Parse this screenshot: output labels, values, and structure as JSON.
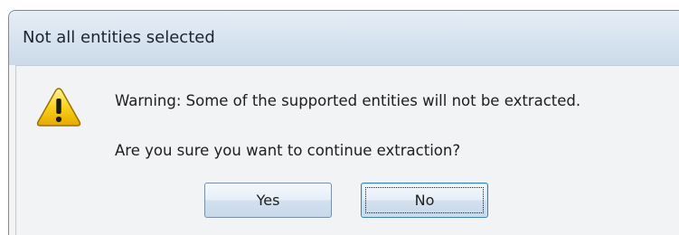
{
  "dialog": {
    "title": "Not all entities selected",
    "icon": "warning-triangle-icon",
    "warning_message": "Warning: Some of the supported entities will not be extracted.",
    "question": "Are you sure you want to continue extraction?",
    "buttons": {
      "yes_label": "Yes",
      "no_label": "No"
    },
    "focused_button": "No"
  },
  "colors": {
    "titlebar": "#d6e3ef",
    "icon_fill": "#f5c400",
    "button_focus_border": "#3c7fb1"
  }
}
